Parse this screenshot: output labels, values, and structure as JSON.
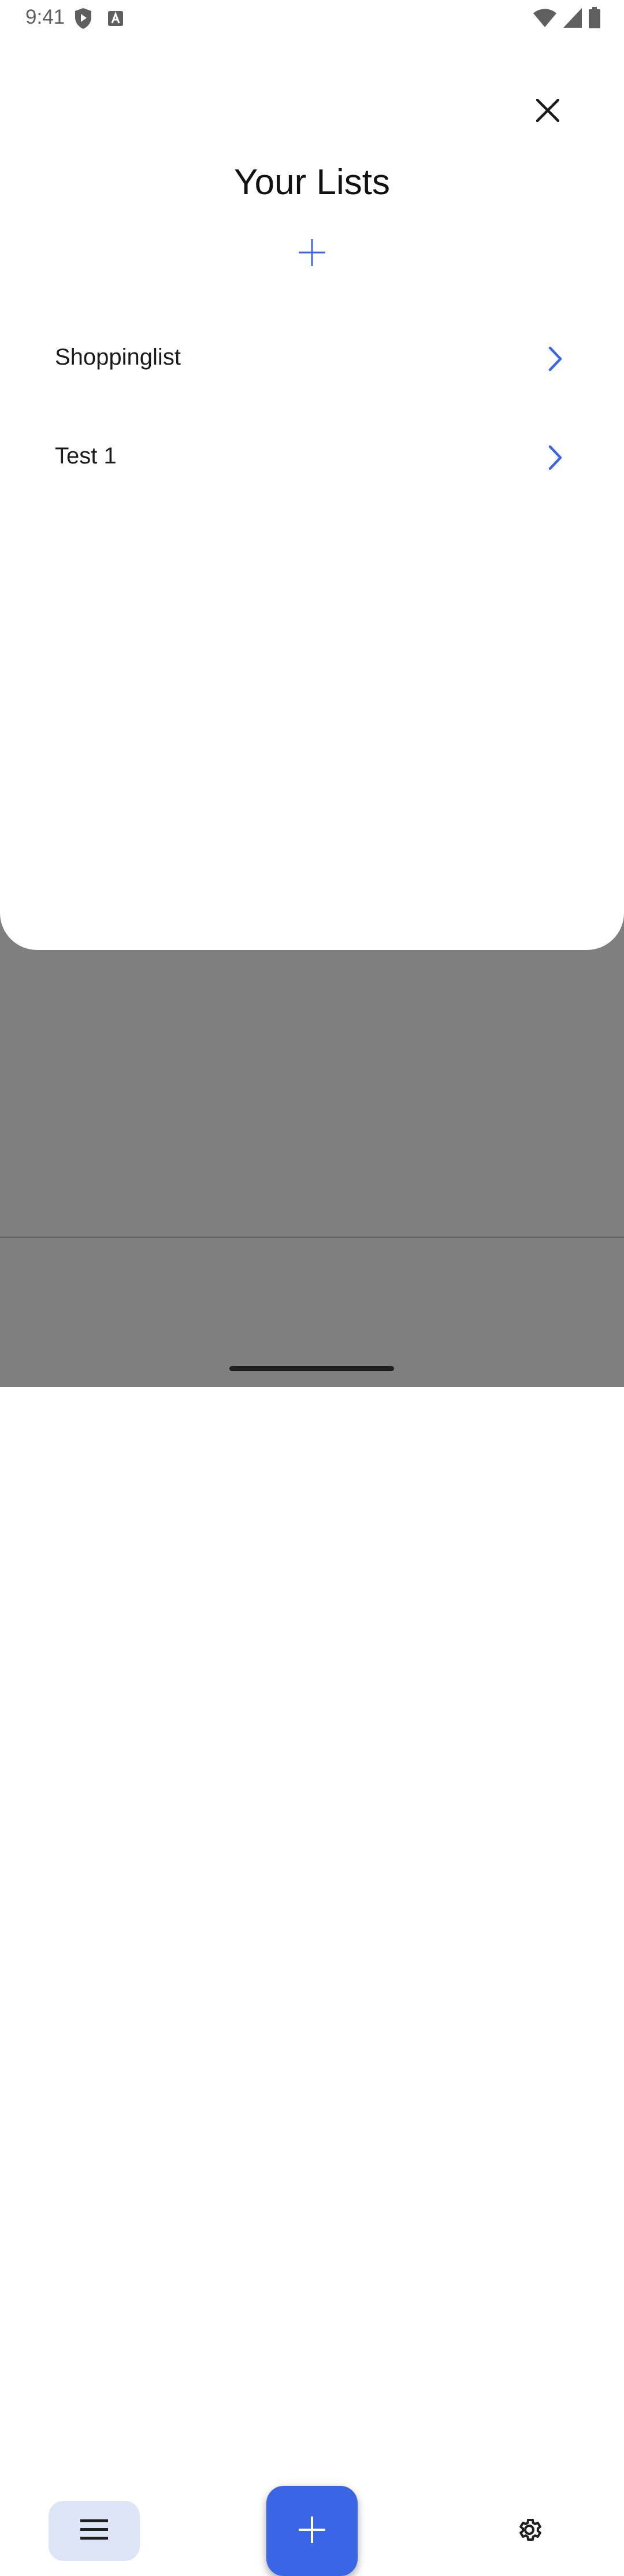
{
  "status_bar": {
    "time": "9:41"
  },
  "header": {
    "title": "Your Lists"
  },
  "lists": [
    {
      "label": "Shoppinglist"
    },
    {
      "label": "Test 1"
    }
  ],
  "colors": {
    "accent": "#3a66e6",
    "scrim": "rgba(0,0,0,0.5)",
    "menu_button_bg": "#dde6f6"
  },
  "icons": {
    "close": "close-icon",
    "add_list": "plus-icon",
    "chevron": "chevron-right-icon",
    "menu": "hamburger-menu-icon",
    "fab": "plus-icon",
    "settings": "gear-icon"
  }
}
